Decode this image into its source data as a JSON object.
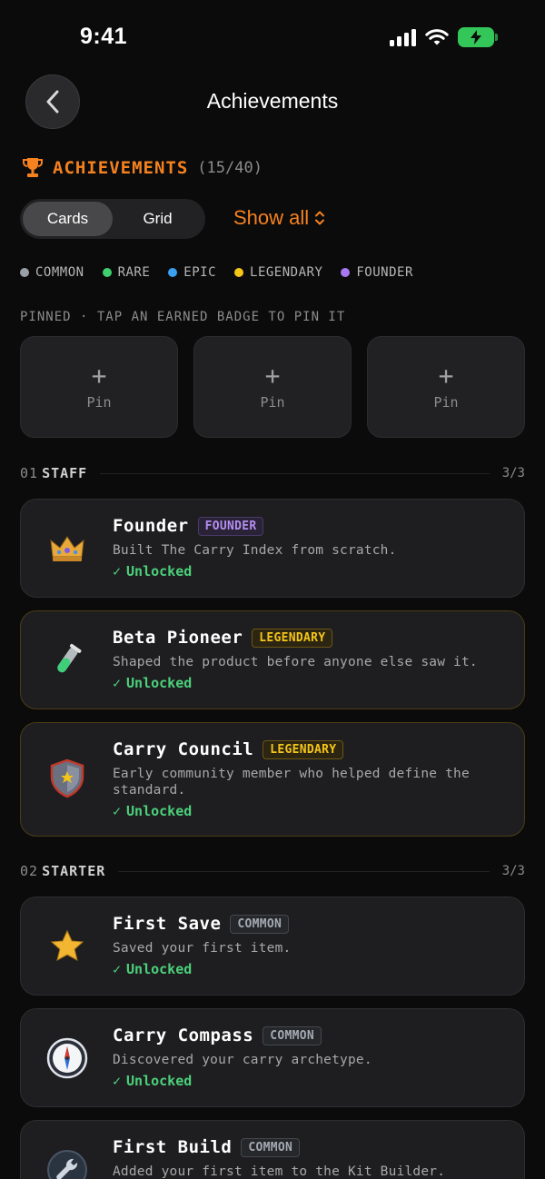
{
  "status_bar": {
    "time": "9:41"
  },
  "nav": {
    "title": "Achievements"
  },
  "header": {
    "title": "ACHIEVEMENTS",
    "count": "(15/40)"
  },
  "view_toggle": {
    "options": [
      "Cards",
      "Grid"
    ],
    "selected": "Cards"
  },
  "show_all": {
    "label": "Show all"
  },
  "legend": [
    {
      "label": "COMMON",
      "color": "#9aa0a8"
    },
    {
      "label": "RARE",
      "color": "#3ecf6e"
    },
    {
      "label": "EPIC",
      "color": "#3aa0f0"
    },
    {
      "label": "LEGENDARY",
      "color": "#f5c518"
    },
    {
      "label": "FOUNDER",
      "color": "#a878f0"
    }
  ],
  "pinned": {
    "label": "PINNED · TAP AN EARNED BADGE TO PIN IT",
    "slots": [
      {
        "label": "Pin"
      },
      {
        "label": "Pin"
      },
      {
        "label": "Pin"
      }
    ]
  },
  "sections": [
    {
      "number": "01",
      "title": "STAFF",
      "count": "3/3",
      "cards": [
        {
          "title": "Founder",
          "rarity": "FOUNDER",
          "desc": "Built The Carry Index from scratch.",
          "status": "Unlocked",
          "icon": "crown-icon"
        },
        {
          "title": "Beta Pioneer",
          "rarity": "LEGENDARY",
          "desc": "Shaped the product before anyone else saw it.",
          "status": "Unlocked",
          "icon": "test-tube-icon"
        },
        {
          "title": "Carry Council",
          "rarity": "LEGENDARY",
          "desc": "Early community member who helped define the standard.",
          "status": "Unlocked",
          "icon": "shield-icon"
        }
      ]
    },
    {
      "number": "02",
      "title": "STARTER",
      "count": "3/3",
      "cards": [
        {
          "title": "First Save",
          "rarity": "COMMON",
          "desc": "Saved your first item.",
          "status": "Unlocked",
          "icon": "star-icon"
        },
        {
          "title": "Carry Compass",
          "rarity": "COMMON",
          "desc": "Discovered your carry archetype.",
          "status": "Unlocked",
          "icon": "compass-icon"
        },
        {
          "title": "First Build",
          "rarity": "COMMON",
          "desc": "Added your first item to the Kit Builder.",
          "status": "",
          "icon": "wrench-icon"
        }
      ]
    }
  ]
}
